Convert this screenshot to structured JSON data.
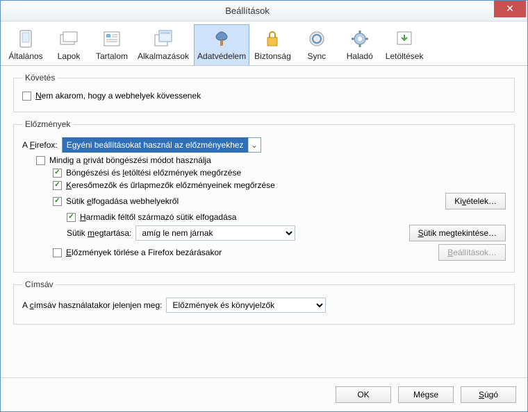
{
  "window": {
    "title": "Beállítások"
  },
  "tabs": {
    "general": {
      "label": "Általános"
    },
    "tabs_": {
      "label": "Lapok"
    },
    "content": {
      "label": "Tartalom"
    },
    "apps": {
      "label": "Alkalmazások"
    },
    "privacy": {
      "label": "Adatvédelem"
    },
    "security": {
      "label": "Biztonság"
    },
    "sync": {
      "label": "Sync"
    },
    "advanced": {
      "label": "Haladó"
    },
    "downloads": {
      "label": "Letöltések"
    }
  },
  "tracking": {
    "legend": "Követés",
    "notrack": "Nem akarom, hogy a webhelyek kövessenek"
  },
  "history": {
    "legend": "Előzmények",
    "firefox_label": "A Firefox:",
    "mode_selected": "Egyéni beállításokat használ az előzményekhez",
    "always_private": "Mindig a privát böngészési módot használja",
    "remember_browsing": "Böngészési és letöltési előzmények megőrzése",
    "remember_search": "Keresőmezők és űrlapmezők előzményeinek megőrzése",
    "accept_cookies": "Sütik elfogadása webhelyekről",
    "exceptions_btn": "Kivételek…",
    "third_party": "Harmadik féltől származó sütik elfogadása",
    "keep_until_label": "Sütik megtartása:",
    "keep_until_value": "amíg le nem járnak",
    "show_cookies_btn": "Sütik megtekintése…",
    "clear_on_close": "Előzmények törlése a Firefox bezárásakor",
    "settings_btn": "Beállítások…"
  },
  "locationbar": {
    "legend": "Címsáv",
    "label": "A címsáv használatakor jelenjen meg:",
    "value": "Előzmények és könyvjelzők"
  },
  "buttons": {
    "ok": "OK",
    "cancel": "Mégse",
    "help": "Súgó"
  }
}
